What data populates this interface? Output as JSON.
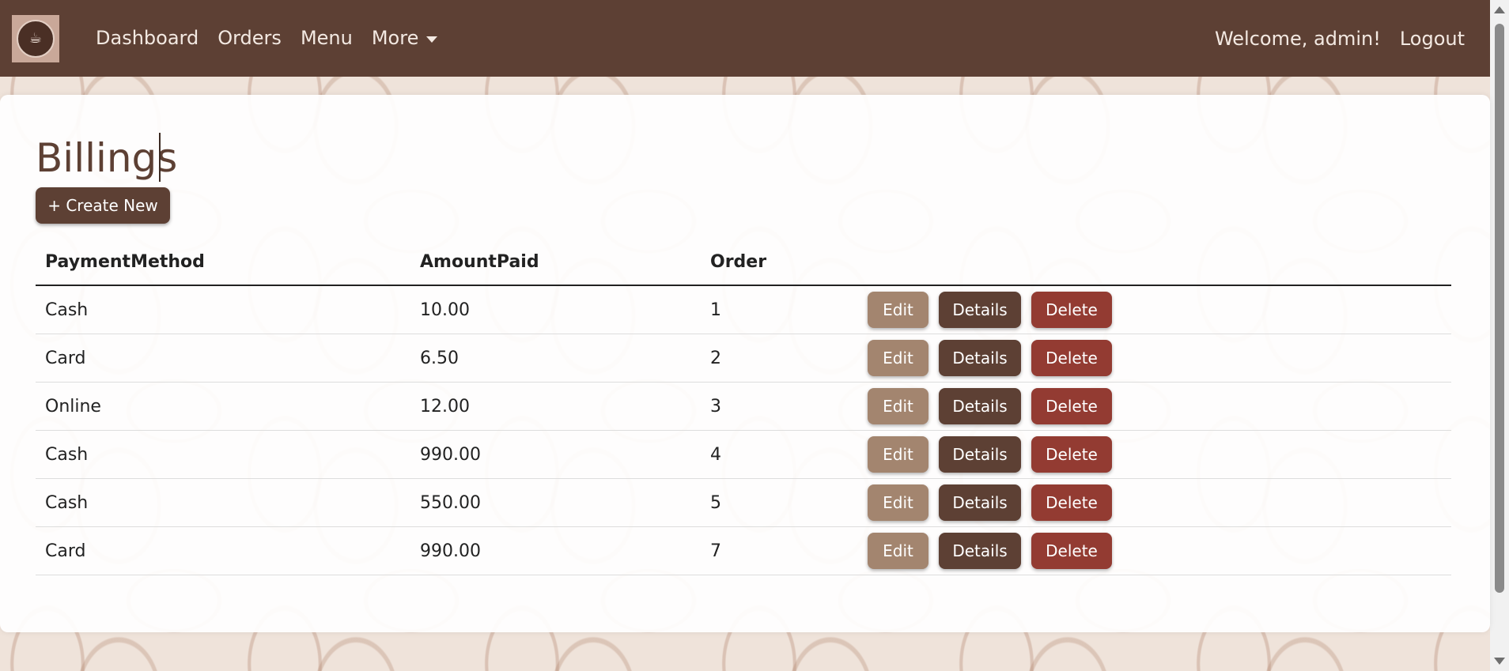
{
  "navbar": {
    "brand_icon": "coffee-logo",
    "links": [
      "Dashboard",
      "Orders",
      "Menu",
      "More"
    ],
    "welcome": "Welcome, admin!",
    "logout": "Logout"
  },
  "page": {
    "title": "Billings",
    "create_label": "+ Create New"
  },
  "table": {
    "headers": [
      "PaymentMethod",
      "AmountPaid",
      "Order"
    ],
    "rows": [
      {
        "method": "Cash",
        "amount": "10.00",
        "order": "1"
      },
      {
        "method": "Card",
        "amount": "6.50",
        "order": "2"
      },
      {
        "method": "Online",
        "amount": "12.00",
        "order": "3"
      },
      {
        "method": "Cash",
        "amount": "990.00",
        "order": "4"
      },
      {
        "method": "Cash",
        "amount": "550.00",
        "order": "5"
      },
      {
        "method": "Card",
        "amount": "990.00",
        "order": "7"
      }
    ],
    "actions": {
      "edit": "Edit",
      "details": "Details",
      "delete": "Delete"
    }
  },
  "colors": {
    "navbar": "#5d4034",
    "primary": "#5d4034",
    "edit": "#a3856f",
    "delete": "#933b32"
  }
}
